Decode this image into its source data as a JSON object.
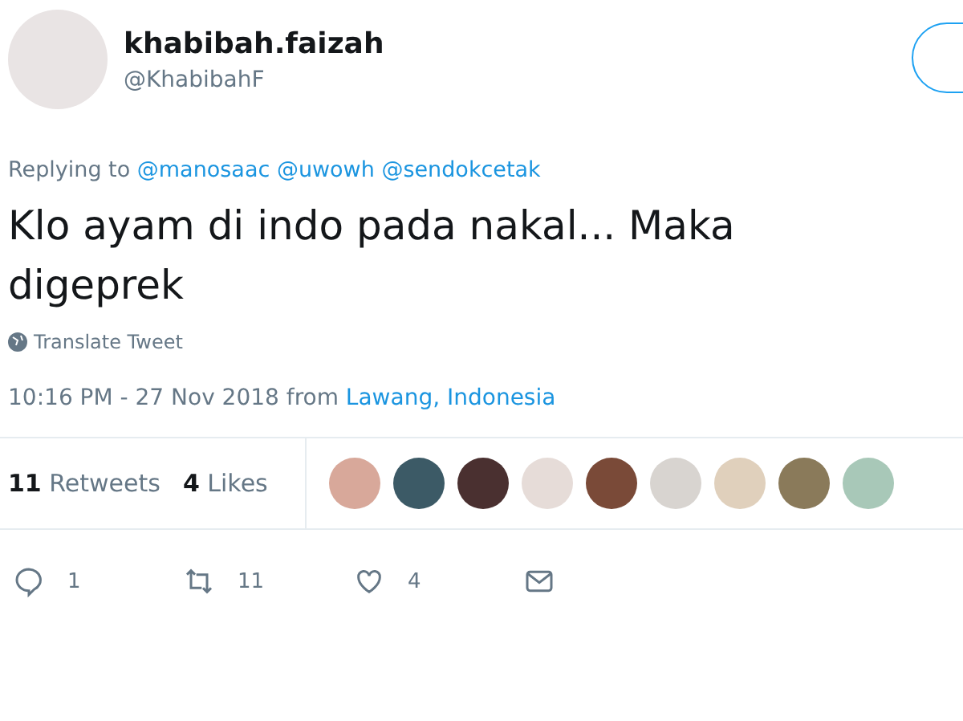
{
  "author": {
    "name": "khabibah.faizah",
    "handle": "@KhabibahF"
  },
  "reply": {
    "prefix": "Replying to",
    "mentions": [
      "@manosaac",
      "@uwowh",
      "@sendokcetak"
    ]
  },
  "tweet_lines": [
    "Klo ayam di indo pada nakal... Maka",
    "digeprek"
  ],
  "translate": "Translate Tweet",
  "timestamp": {
    "time": "10:16 PM - 27 Nov 2018 from",
    "place": "Lawang, Indonesia"
  },
  "stats": [
    {
      "count": "11",
      "label": "Retweets"
    },
    {
      "count": "4",
      "label": "Likes"
    }
  ],
  "likers": [
    {
      "color": "#d8a89a"
    },
    {
      "color": "#3c5a66"
    },
    {
      "color": "#4a3030"
    },
    {
      "color": "#e6dcd8"
    },
    {
      "color": "#7a4a38"
    },
    {
      "color": "#d8d4d0"
    },
    {
      "color": "#e0d0bc"
    },
    {
      "color": "#8a7a5a"
    },
    {
      "color": "#a8c8b8"
    }
  ],
  "actions": [
    {
      "kind": "reply",
      "count": "1"
    },
    {
      "kind": "retweet",
      "count": "11"
    },
    {
      "kind": "like",
      "count": "4"
    },
    {
      "kind": "message"
    }
  ]
}
